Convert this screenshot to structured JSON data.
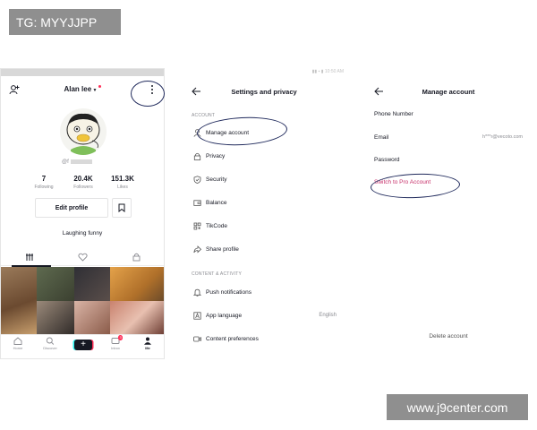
{
  "watermarks": {
    "top": "TG: MYYJJPP",
    "bottom": "www.j9center.com"
  },
  "profile": {
    "name": "Alan lee",
    "username": "@f",
    "stats": [
      {
        "value": "7",
        "label": "Following"
      },
      {
        "value": "20.4K",
        "label": "Followers"
      },
      {
        "value": "151.3K",
        "label": "Likes"
      }
    ],
    "edit_label": "Edit profile",
    "bio": "Laughing funny",
    "nav": [
      {
        "label": "Home",
        "icon": "home-icon"
      },
      {
        "label": "Discover",
        "icon": "search-icon"
      },
      {
        "label": "",
        "icon": "plus-icon"
      },
      {
        "label": "Inbox",
        "icon": "inbox-icon",
        "badge": "3"
      },
      {
        "label": "Me",
        "icon": "person-icon"
      }
    ]
  },
  "settings": {
    "title": "Settings and privacy",
    "account_section": "ACCOUNT",
    "account_items": [
      {
        "label": "Manage account",
        "icon": "person-icon"
      },
      {
        "label": "Privacy",
        "icon": "lock-icon"
      },
      {
        "label": "Security",
        "icon": "shield-icon"
      },
      {
        "label": "Balance",
        "icon": "wallet-icon"
      },
      {
        "label": "TikCode",
        "icon": "qr-icon"
      },
      {
        "label": "Share profile",
        "icon": "share-icon"
      }
    ],
    "content_section": "CONTENT & ACTIVITY",
    "content_items": [
      {
        "label": "Push notifications",
        "icon": "bell-icon",
        "value": ""
      },
      {
        "label": "App language",
        "icon": "language-icon",
        "value": "English"
      },
      {
        "label": "Content preferences",
        "icon": "video-icon",
        "value": ""
      }
    ]
  },
  "manage": {
    "title": "Manage account",
    "phone_label": "Phone Number",
    "email_label": "Email",
    "email_value": "h***r@vecoto.com",
    "password_label": "Password",
    "pro_label": "Switch to Pro Account",
    "delete_label": "Delete account"
  },
  "colors": {
    "accent": "#fe2c55",
    "pro": "#c7336c",
    "annotation": "#202a5c"
  }
}
